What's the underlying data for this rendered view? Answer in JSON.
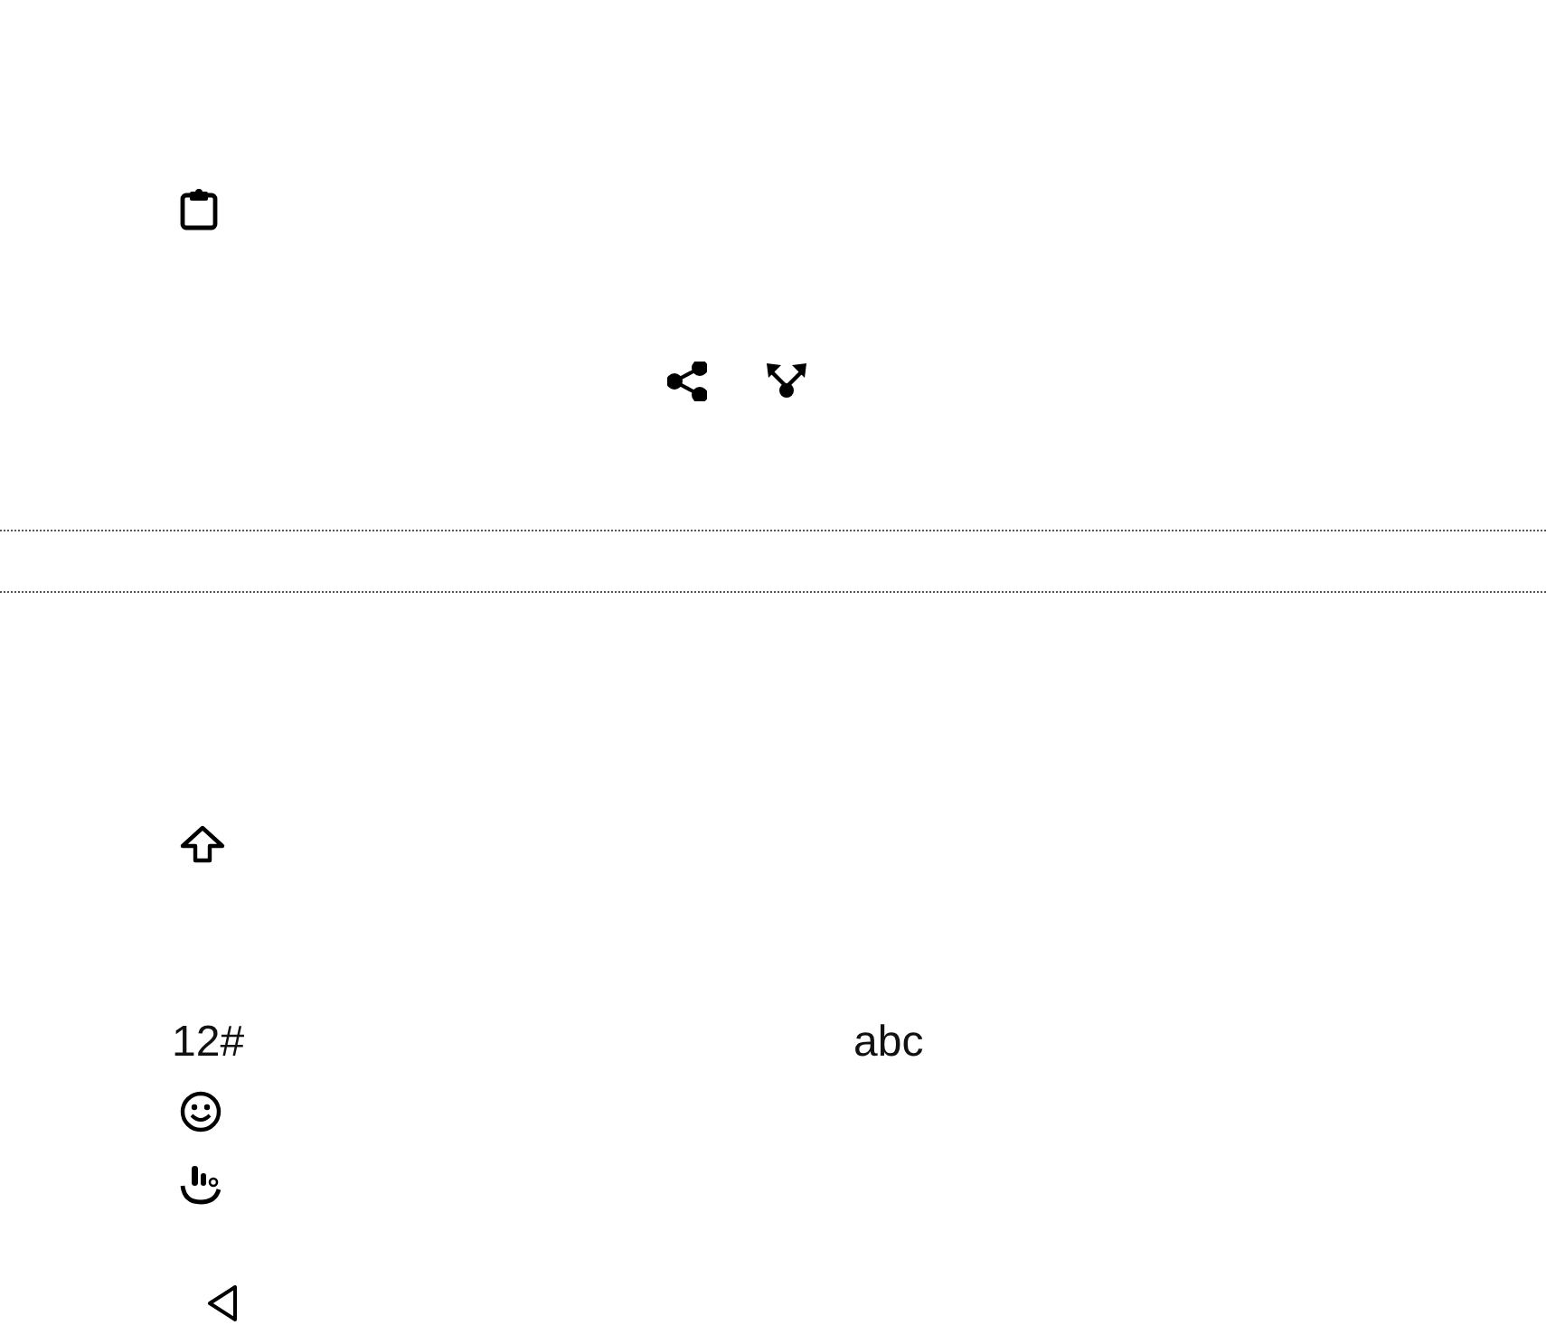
{
  "keyboard": {
    "symbols_key": "12#",
    "letters_key": "abc"
  }
}
